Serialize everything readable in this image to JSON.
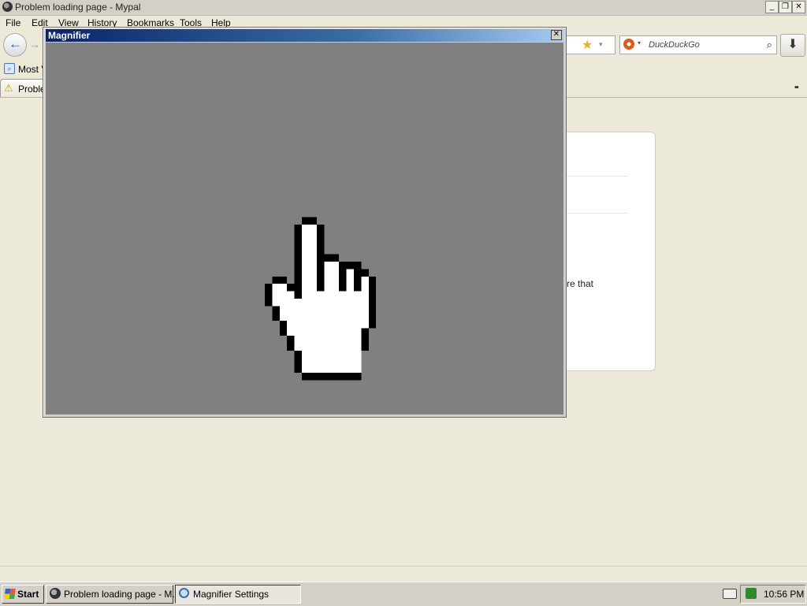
{
  "browser": {
    "window_title": "Problem loading page - Mypal",
    "window_buttons": {
      "minimize": "_",
      "restore": "❐",
      "close": "✕"
    },
    "menu": [
      "File",
      "Edit",
      "View",
      "History",
      "Bookmarks",
      "Tools",
      "Help"
    ],
    "nav": {
      "back_glyph": "←",
      "forward_glyph": "→"
    },
    "search": {
      "placeholder": "DuckDuckGo",
      "engine_icon": "duckduckgo-icon",
      "go_glyph": "⌕"
    },
    "bookmark_star_glyph": "★",
    "dropdown_glyph": "▾",
    "download_glyph": "⬇",
    "bookmarks_bar": {
      "item_label": "Most V"
    },
    "tabs": [
      {
        "label": "Proble",
        "icon": "warning-icon",
        "icon_glyph": "⚠"
      }
    ],
    "tablist_glyph": "▪▪",
    "error_page": {
      "visible_text": "re that"
    }
  },
  "magnifier": {
    "title": "Magnifier",
    "close_glyph": "✕",
    "background_color": "#808080",
    "content_icon": "hand-pointer-cursor-icon"
  },
  "taskbar": {
    "start_label": "Start",
    "tasks": [
      {
        "label": "Problem loading page - M...",
        "icon": "mypal-icon"
      },
      {
        "label": "Magnifier Settings",
        "icon": "magnifier-icon"
      }
    ],
    "clock": "10:56 PM"
  }
}
